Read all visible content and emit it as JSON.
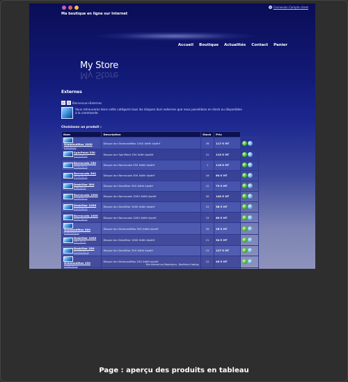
{
  "header": {
    "tagline": "Ma boutique en ligne sur Internet",
    "login_link": "Connexion Compte client",
    "flag_colors": [
      "#c060c0",
      "#e06060",
      "#f0c040"
    ]
  },
  "nav": [
    "Accueil",
    "Boutique",
    "Actualités",
    "Contact",
    "Panier"
  ],
  "brand": "My Store",
  "section": {
    "title": "Externes",
    "breadcrumb": "Bienvenue>Externes",
    "description": "Vous retrouverez dans cette catégorie tous les disques durs externes que nous possédons en stock ou disponibles à la commande.",
    "choose_label": "Choisissez un produit :"
  },
  "table": {
    "headers": [
      "Nom",
      "Description",
      "Stock",
      "Prix"
    ],
    "rows": [
      {
        "name": "DiamondMax 1000",
        "ref": "(P65-02-2)",
        "description": "Disque dur DiamondMax 1000 Xdtlh kjsdhf",
        "stock": "39",
        "price": "117 € HT"
      },
      {
        "name": "SpinPoint 250",
        "ref": "(P470-02-2)",
        "description": "Disque dur SpinPoint 250 Xdtlh kjsdhf",
        "stock": "41",
        "price": "115 € HT"
      },
      {
        "name": "Barracuda 250",
        "ref": "(P348-02-2)",
        "description": "Disque dur Barracuda 250 Xdtlh kjsdhf",
        "stock": "1",
        "price": "116 € HT"
      },
      {
        "name": "Barracuda 500",
        "ref": "(P258-02-2)",
        "description": "Disque dur Barracuda 500 Xdtlh kjsdhf",
        "stock": "16",
        "price": "64 € HT"
      },
      {
        "name": "DeskStar 500",
        "ref": "(P86-02-2)",
        "description": "Disque dur DeskStar 500 Xdtlh kjsdhf",
        "stock": "41",
        "price": "79 € HT"
      },
      {
        "name": "Barracuda 1000",
        "ref": "(P256-02-1)",
        "description": "Disque dur Barracuda 1000 Xdtlh kjsdhf",
        "stock": "50",
        "price": "140 € HT"
      },
      {
        "name": "DeskStar 1000",
        "ref": "(P259-02-2)",
        "description": "Disque dur DeskStar 1000 Xdtlh kjsdhf",
        "stock": "15",
        "price": "58 € HT"
      },
      {
        "name": "Barracuda 1000",
        "ref": "(P247-02-1)",
        "description": "Disque dur Barracuda 1000 Xdtlh kjsdhf",
        "stock": "15",
        "price": "60 € HT"
      },
      {
        "name": "DiamondMax 500",
        "ref": "(P1025-02-2)",
        "description": "Disque dur DiamondMax 500 Xdtlh kjsdhf",
        "stock": "39",
        "price": "26 € HT"
      },
      {
        "name": "DeskStar 1000",
        "ref": "(P87-02-2)",
        "description": "Disque dur DeskStar 1000 Xdtlh kjsdhf",
        "stock": "21",
        "price": "54 € HT"
      },
      {
        "name": "DeskStar 250",
        "ref": "(P1145-02-1)",
        "description": "Disque dur DeskStar 250 Xdtlh kjsdhf",
        "stock": "15",
        "price": "127 € HT"
      },
      {
        "name": "DiamondMax 250",
        "ref": "(P488-02-1)",
        "description": "Disque dur DiamondMax 250 Xdtlh kjsdhf",
        "stock": "12",
        "price": "49 € HT"
      },
      {
        "name": "DeskStar 500",
        "ref": "(P1470-02-1)",
        "description": "Hitachi - Disque dur - DeskStar 500 Go - 8 Mo - 7 200 tours/min",
        "stock": "22",
        "price": "79 € HT"
      }
    ]
  },
  "footer": "Site internet sur Mamiutuco - Bonflamo Hosting",
  "caption": "Page : aperçu des produits en tableau"
}
